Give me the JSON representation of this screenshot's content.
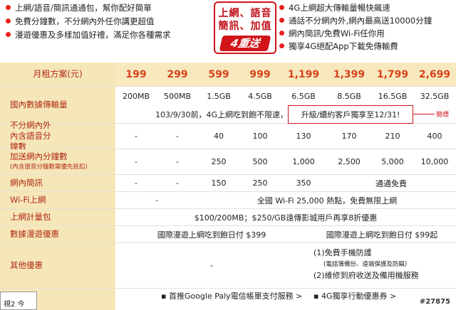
{
  "bullets_left": [
    "上網/語音/簡訊通通包，幫你配好簡單",
    "免費分鐘數，不分網內外任你講更超值",
    "漫遊優惠及多樣加值好禮，滿足你各種需求"
  ],
  "bullets_right": [
    "4G上網超大傳輸量暢快飆速",
    "通話不分網內外,網內最高送10000分鐘",
    "網內簡訊/免費Wi-Fi任你用",
    "獨享4G絕配App下載免傳輸費"
  ],
  "badge": {
    "line1": "上網、語音",
    "line2": "簡訊、加值",
    "line3": "4重送"
  },
  "header": {
    "label": "月租方案(元)",
    "plans": [
      "199",
      "299",
      "599",
      "999",
      "1,199",
      "1,399",
      "1,799",
      "2,699"
    ]
  },
  "data": {
    "label": "國內數據傳輸量",
    "values": [
      "200MB",
      "500MB",
      "1.5GB",
      "4.5GB",
      "6.5GB",
      "8.5GB",
      "16.5GB",
      "32.5GB"
    ],
    "promo_a": "103/9/30前，4G上網吃到飽不限速，",
    "promo_b": "升級/續約客戶獨享至12/31!",
    "note": "簡標"
  },
  "voice": {
    "label": "不分網內外內含語音分鐘數",
    "values": [
      "-",
      "-",
      "40",
      "100",
      "130",
      "170",
      "210",
      "400"
    ]
  },
  "bonus": {
    "label": "加送網內分鐘數",
    "sub": "(內含語音分鐘數需優先抵扣)",
    "values": [
      "-",
      "-",
      "250",
      "500",
      "1,000",
      "2,500",
      "5,000",
      "10,000"
    ]
  },
  "sms": {
    "label": "網內簡訊",
    "values": [
      "-",
      "-",
      "150",
      "250",
      "350"
    ],
    "free": "通通免費"
  },
  "wifi": {
    "label": "Wi-Fi上網",
    "dash": "-",
    "text": "全國 Wi-Fi 25,000 熱點，免費無限上網"
  },
  "metered": {
    "label": "上網計量包",
    "text": "$100/200MB；$250/GB遠傳影城用戶再享8折優惠"
  },
  "roaming": {
    "label": "數據漫遊優惠",
    "left": "國際漫遊上網吃到飽日付 $399",
    "right": "國際漫遊上網吃到飽日付 $99起"
  },
  "other": {
    "label": "其他優惠",
    "dash": "-",
    "l1": "(1)免費手機防護",
    "l2": "(電話簿備份、遠端保護及防竊)",
    "l3": "(2)維修到府收送及備用機服務"
  },
  "last": {
    "a": "▪ 首推Google Paly電信帳單支付服務 >",
    "b": "▪ 4G獨享行動優惠券 >"
  },
  "corner": "視2 今",
  "watermark": "#27875"
}
